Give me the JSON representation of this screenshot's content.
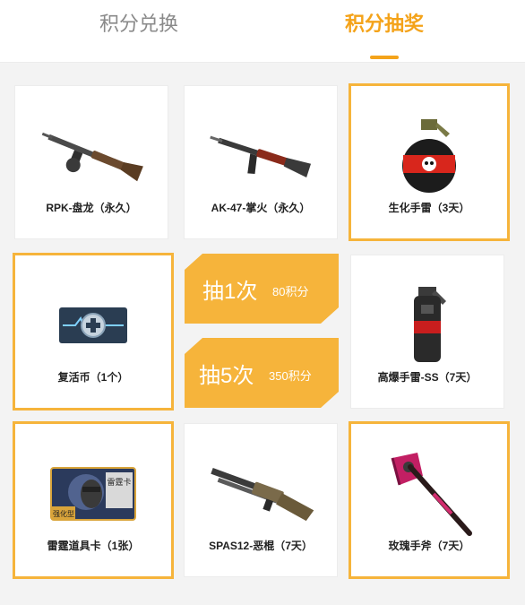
{
  "tabs": {
    "exchange": "积分兑换",
    "lottery": "积分抽奖"
  },
  "prizes": [
    {
      "name": "RPK-盘龙（永久）",
      "icon": "rifle-rpk-icon"
    },
    {
      "name": "AK-47-掌火（永久）",
      "icon": "rifle-ak47-icon"
    },
    {
      "name": "生化手雷（3天）",
      "icon": "bio-grenade-icon"
    },
    {
      "name": "复活币（1个）",
      "icon": "revive-coin-icon"
    },
    {
      "name": "高爆手雷-SS（7天）",
      "icon": "he-grenade-icon"
    },
    {
      "name": "雷霆道具卡（1张）",
      "icon": "thunder-card-icon"
    },
    {
      "name": "SPAS12-恶棍（7天）",
      "icon": "shotgun-spas12-icon"
    },
    {
      "name": "玫瑰手斧（7天）",
      "icon": "rose-axe-icon"
    }
  ],
  "draw": [
    {
      "label": "抽1次",
      "cost": "80积分"
    },
    {
      "label": "抽5次",
      "cost": "350积分"
    }
  ],
  "colors": {
    "accent": "#f4a31a",
    "selected_border": "#f6b43b",
    "button": "#f6b43b"
  },
  "card_art": {
    "thunder_card_badge": "雷霆卡",
    "thunder_card_sub": "强化型"
  }
}
